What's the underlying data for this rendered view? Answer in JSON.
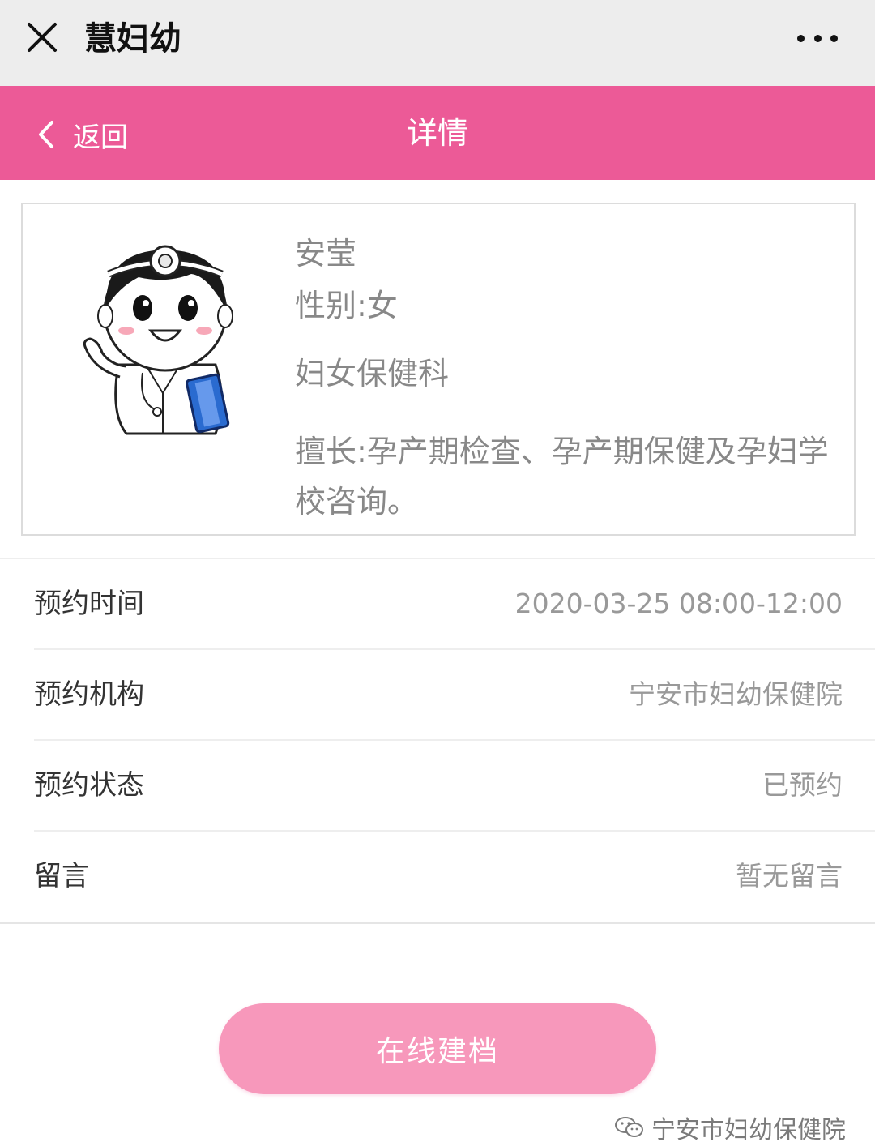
{
  "titlebar": {
    "title": "慧妇幼"
  },
  "nav": {
    "back_label": "返回",
    "title": "详情"
  },
  "doctor": {
    "name": "安莹",
    "gender": "性别:女",
    "department": "妇女保健科",
    "specialty": "擅长:孕产期检查、孕产期保健及孕妇学校咨询。"
  },
  "details": [
    {
      "label": "预约时间",
      "value": "2020-03-25 08:00-12:00"
    },
    {
      "label": "预约机构",
      "value": "宁安市妇幼保健院"
    },
    {
      "label": "预约状态",
      "value": "已预约"
    },
    {
      "label": "留言",
      "value": "暂无留言"
    }
  ],
  "action": {
    "button_label": "在线建档"
  },
  "watermark": {
    "text": "宁安市妇幼保健院"
  },
  "colors": {
    "brand_pink": "#ec5a97",
    "button_pink": "#f798bb",
    "titlebar_gray": "#ededed"
  }
}
